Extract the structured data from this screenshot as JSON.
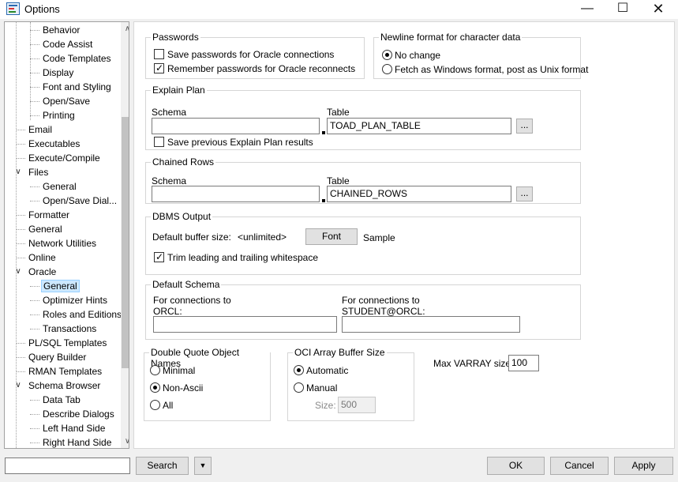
{
  "window": {
    "title": "Options",
    "controls": {
      "minimize": "—",
      "maximize": "☐",
      "close": "✕"
    }
  },
  "tree": {
    "items": [
      {
        "label": "Behavior",
        "level": 2
      },
      {
        "label": "Code Assist",
        "level": 2
      },
      {
        "label": "Code Templates",
        "level": 2
      },
      {
        "label": "Display",
        "level": 2
      },
      {
        "label": "Font and Styling",
        "level": 2
      },
      {
        "label": "Open/Save",
        "level": 2
      },
      {
        "label": "Printing",
        "level": 2
      },
      {
        "label": "Email",
        "level": 1
      },
      {
        "label": "Executables",
        "level": 1
      },
      {
        "label": "Execute/Compile",
        "level": 1
      },
      {
        "label": "Files",
        "level": 1,
        "expanded": true
      },
      {
        "label": "General",
        "level": 2
      },
      {
        "label": "Open/Save Dial...",
        "level": 2
      },
      {
        "label": "Formatter",
        "level": 1
      },
      {
        "label": "General",
        "level": 1
      },
      {
        "label": "Network Utilities",
        "level": 1
      },
      {
        "label": "Online",
        "level": 1
      },
      {
        "label": "Oracle",
        "level": 1,
        "expanded": true
      },
      {
        "label": "General",
        "level": 2,
        "selected": true
      },
      {
        "label": "Optimizer Hints",
        "level": 2
      },
      {
        "label": "Roles and Editions",
        "level": 2
      },
      {
        "label": "Transactions",
        "level": 2
      },
      {
        "label": "PL/SQL Templates",
        "level": 1
      },
      {
        "label": "Query Builder",
        "level": 1
      },
      {
        "label": "RMAN Templates",
        "level": 1
      },
      {
        "label": "Schema Browser",
        "level": 1,
        "expanded": true
      },
      {
        "label": "Data Tab",
        "level": 2
      },
      {
        "label": "Describe Dialogs",
        "level": 2
      },
      {
        "label": "Left Hand Side",
        "level": 2
      },
      {
        "label": "Right Hand Side",
        "level": 2
      }
    ],
    "expand_glyph": "∨",
    "scroll_up": "∧",
    "scroll_down": "∨"
  },
  "passwords": {
    "title": "Passwords",
    "save_label": "Save passwords for Oracle connections",
    "save_checked": false,
    "remember_label": "Remember passwords for Oracle reconnects",
    "remember_checked": true
  },
  "newline": {
    "title": "Newline format for character data",
    "no_change_label": "No change",
    "fetch_label": "Fetch as Windows format, post as Unix format",
    "selected": "no_change"
  },
  "explain_plan": {
    "title": "Explain Plan",
    "schema_label": "Schema",
    "schema_value": "",
    "table_label": "Table",
    "table_value": "TOAD_PLAN_TABLE",
    "browse_label": "...",
    "save_prev_label": "Save previous Explain Plan results",
    "save_prev_checked": false
  },
  "chained_rows": {
    "title": "Chained Rows",
    "schema_label": "Schema",
    "schema_value": "",
    "table_label": "Table",
    "table_value": "CHAINED_ROWS",
    "browse_label": "..."
  },
  "dbms_output": {
    "title": "DBMS Output",
    "buffer_label": "Default buffer size:",
    "buffer_value": "<unlimited>",
    "font_button": "Font",
    "sample_label": "Sample",
    "trim_label": "Trim leading and trailing whitespace",
    "trim_checked": true
  },
  "default_schema": {
    "title": "Default Schema",
    "conn1_label_line1": "For connections to",
    "conn1_label_line2": "ORCL:",
    "conn1_value": "",
    "conn2_label_line1": "For connections to",
    "conn2_label_line2": "STUDENT@ORCL:",
    "conn2_value": ""
  },
  "double_quote": {
    "title": "Double Quote Object Names",
    "minimal_label": "Minimal",
    "nonascii_label": "Non-Ascii",
    "all_label": "All",
    "selected": "nonascii"
  },
  "oci_array": {
    "title": "OCI Array Buffer Size",
    "automatic_label": "Automatic",
    "manual_label": "Manual",
    "selected": "automatic",
    "size_label": "Size:",
    "size_value": "500"
  },
  "varray": {
    "label": "Max VARRAY size:",
    "value": "100"
  },
  "bottom": {
    "search_value": "",
    "search_button": "Search",
    "dropdown_glyph": "▼",
    "ok": "OK",
    "cancel": "Cancel",
    "apply": "Apply"
  },
  "colors": {
    "selection_bg": "#cce8ff",
    "selection_border": "#99d1ff",
    "button_bg": "#e1e1e1",
    "panel_bg": "#ffffff",
    "window_bg": "#f0f0f0"
  }
}
